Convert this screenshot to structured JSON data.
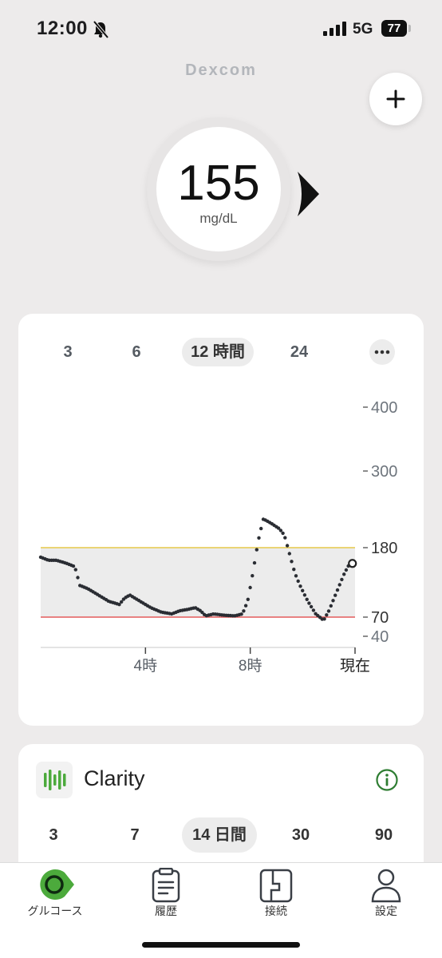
{
  "status_bar": {
    "time": "12:00",
    "network": "5G",
    "battery": "77"
  },
  "app": {
    "logo": "Dexcom",
    "add_button": "+"
  },
  "glucose": {
    "value": "155",
    "unit": "mg/dL",
    "trend": "steady"
  },
  "chart_card": {
    "range_tabs": [
      {
        "label": "3"
      },
      {
        "label": "6"
      },
      {
        "label": "12 時間",
        "active": true
      },
      {
        "label": "24"
      }
    ],
    "more_icon": "ellipsis-icon"
  },
  "chart_data": {
    "type": "scatter",
    "x_unit": "hours",
    "xlim": [
      0,
      12
    ],
    "x_ticks": [
      {
        "x": 4,
        "label": "4時"
      },
      {
        "x": 8,
        "label": "8時"
      },
      {
        "x": 12,
        "label": "現在"
      }
    ],
    "y_ticks": [
      400,
      300,
      180,
      70,
      40
    ],
    "y_tick_labels": [
      "400",
      "300",
      "180",
      "70",
      "40"
    ],
    "ylim": [
      0,
      400
    ],
    "high_threshold": 180,
    "low_threshold": 70,
    "target_band": [
      70,
      180
    ],
    "colors": {
      "high_line": "#e6c84a",
      "low_line": "#e45b5b",
      "band": "#ececec",
      "points": "#2a2d33"
    },
    "keypoints": [
      [
        0,
        165
      ],
      [
        0.3,
        160
      ],
      [
        0.6,
        160
      ],
      [
        1.0,
        155
      ],
      [
        1.3,
        150
      ],
      [
        1.5,
        120
      ],
      [
        1.8,
        115
      ],
      [
        2.2,
        105
      ],
      [
        2.6,
        95
      ],
      [
        3.0,
        90
      ],
      [
        3.2,
        100
      ],
      [
        3.4,
        105
      ],
      [
        3.8,
        95
      ],
      [
        4.2,
        85
      ],
      [
        4.6,
        78
      ],
      [
        5.0,
        75
      ],
      [
        5.3,
        80
      ],
      [
        5.6,
        82
      ],
      [
        5.9,
        85
      ],
      [
        6.1,
        80
      ],
      [
        6.3,
        72
      ],
      [
        6.6,
        75
      ],
      [
        7.0,
        73
      ],
      [
        7.4,
        72
      ],
      [
        7.7,
        75
      ],
      [
        7.9,
        95
      ],
      [
        8.1,
        140
      ],
      [
        8.3,
        190
      ],
      [
        8.5,
        225
      ],
      [
        8.8,
        218
      ],
      [
        9.1,
        210
      ],
      [
        9.3,
        200
      ],
      [
        9.5,
        170
      ],
      [
        9.7,
        140
      ],
      [
        9.9,
        120
      ],
      [
        10.2,
        95
      ],
      [
        10.5,
        75
      ],
      [
        10.8,
        65
      ],
      [
        11.0,
        80
      ],
      [
        11.3,
        110
      ],
      [
        11.6,
        140
      ],
      [
        11.8,
        155
      ]
    ],
    "current": {
      "x": 11.9,
      "y": 155
    }
  },
  "clarity": {
    "title": "Clarity",
    "range_tabs": [
      {
        "label": "3"
      },
      {
        "label": "7"
      },
      {
        "label": "14 日間",
        "active": true
      },
      {
        "label": "30"
      },
      {
        "label": "90"
      }
    ]
  },
  "tab_bar": [
    {
      "label": "グルコース",
      "icon": "glucose-icon",
      "active": true
    },
    {
      "label": "履歴",
      "icon": "history-clipboard-icon"
    },
    {
      "label": "接続",
      "icon": "connection-icon"
    },
    {
      "label": "設定",
      "icon": "person-icon"
    }
  ]
}
